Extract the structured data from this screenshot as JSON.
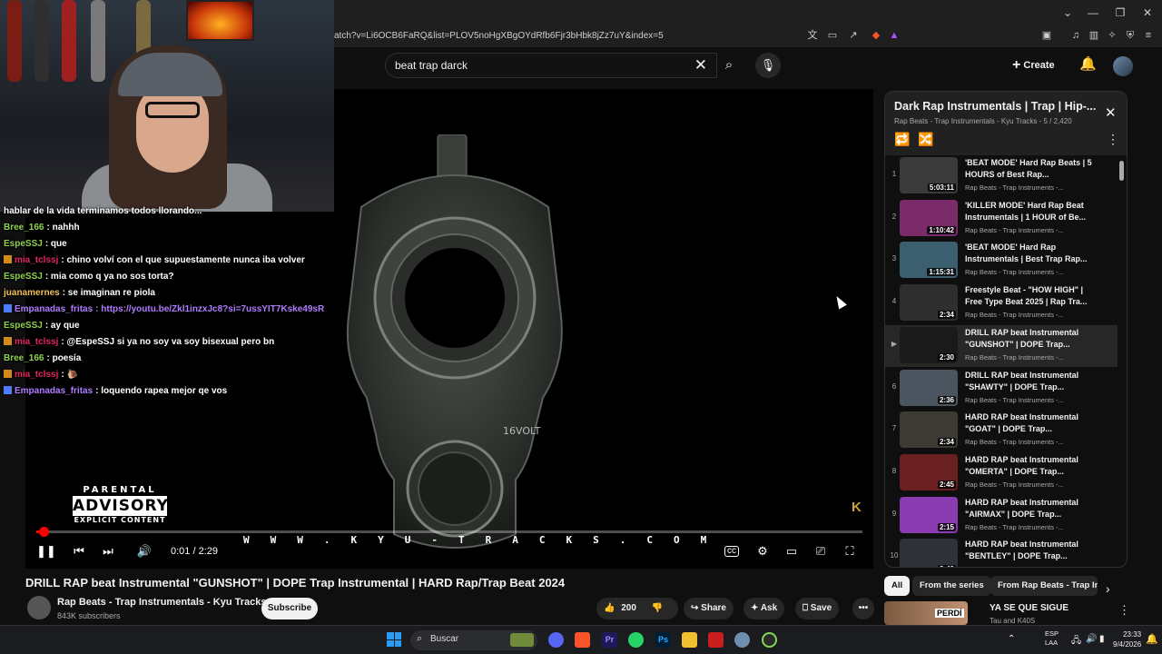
{
  "browser": {
    "url": "atch?v=Li6OCB6FaRQ&list=PLOV5noHgXBgOYdRfb6Fjr3bHbk8jZz7uY&index=5"
  },
  "header": {
    "search_value": "beat trap darck",
    "create_label": "Create"
  },
  "chat": [
    {
      "user": "hablar de la vida terminamos todos llorando...",
      "text": "",
      "color": "#ffffff",
      "badge": ""
    },
    {
      "user": "Bree_166",
      "text": ": nahhh",
      "color": "#8fd14f",
      "badge": ""
    },
    {
      "user": "EspeSSJ",
      "text": ": que",
      "color": "#8fd14f",
      "badge": ""
    },
    {
      "user": "mia_tclssj",
      "text": ": chino volví con el que supuestamente nunca iba volver",
      "color": "#e0245e",
      "badge": "orange"
    },
    {
      "user": "EspeSSJ",
      "text": ": mia como q ya no sos torta?",
      "color": "#8fd14f",
      "badge": ""
    },
    {
      "user": "juanamernes",
      "text": ": se imaginan re piola",
      "color": "#f0c05a",
      "badge": ""
    },
    {
      "user": "Empanadas_fritas",
      "text": ": https://youtu.be/Zkl1inzxJc8?si=7ussYIT7Kske49sR",
      "color": "#b07cff",
      "badge": "blue"
    },
    {
      "user": "EspeSSJ",
      "text": ": ay que",
      "color": "#8fd14f",
      "badge": ""
    },
    {
      "user": "mia_tclssj",
      "text": ": @EspeSSJ si ya no soy va soy bisexual pero bn",
      "color": "#e0245e",
      "badge": "orange"
    },
    {
      "user": "Bree_166",
      "text": ": poesía",
      "color": "#8fd14f",
      "badge": ""
    },
    {
      "user": "mia_tclssj",
      "text": ": 🐌",
      "color": "#e0245e",
      "badge": "orange"
    },
    {
      "user": "Empanadas_fritas",
      "text": ": loquendo rapea mejor qe vos",
      "color": "#b07cff",
      "badge": "blue"
    }
  ],
  "player": {
    "advisory_l1": "PARENTAL",
    "advisory_l2": "ADVISORY",
    "advisory_l3": "EXPLICIT CONTENT",
    "gun_brand": "16VOLT",
    "watermark": "K",
    "site": "WWW.KYU-TRACKS.COM",
    "time": "0:01 / 2:29",
    "progress": 0.007
  },
  "video": {
    "title": "DRILL RAP beat Instrumental \"GUNSHOT\" | DOPE Trap Instrumental | HARD Rap/Trap Beat 2024",
    "channel": "Rap Beats - Trap Instrumentals - Kyu Tracks",
    "subscribers": "843K subscribers",
    "subscribe_label": "Subscribe",
    "likes": "200",
    "share_label": "Share",
    "ask_label": "Ask",
    "save_label": "Save"
  },
  "playlist": {
    "title": "Dark Rap Instrumentals | Trap | Hip-...",
    "subtitle": "Rap Beats - Trap Instrumentals - Kyu Tracks - 5 / 2,420",
    "items": [
      {
        "idx": "1",
        "title": "'BEAT MODE' Hard Rap Beats | 5 HOURS of Best Rap...",
        "channel": "Rap Beats - Trap Instruments -...",
        "dur": "5:03:11",
        "thumb": "#3a3a3a"
      },
      {
        "idx": "2",
        "title": "'KILLER MODE' Hard Rap Beat Instrumentals | 1 HOUR of Be...",
        "channel": "Rap Beats - Trap Instruments -...",
        "dur": "1:10:42",
        "thumb": "#7b2a6a"
      },
      {
        "idx": "3",
        "title": "'BEAT MODE' Hard Rap Instrumentals | Best Trap Rap...",
        "channel": "Rap Beats - Trap Instruments -...",
        "dur": "1:15:31",
        "thumb": "#3b5f6e"
      },
      {
        "idx": "4",
        "title": "Freestyle Beat - \"HOW HIGH\" | Free Type Beat 2025 | Rap Tra...",
        "channel": "Rap Beats - Trap Instruments -...",
        "dur": "2:34",
        "thumb": "#2e2e2e"
      },
      {
        "idx": "▶",
        "title": "DRILL RAP beat Instrumental \"GUNSHOT\" | DOPE Trap...",
        "channel": "Rap Beats - Trap Instruments -...",
        "dur": "2:30",
        "thumb": "#1a1a1a"
      },
      {
        "idx": "6",
        "title": "DRILL RAP beat Instrumental \"SHAWTY\" | DOPE Trap...",
        "channel": "Rap Beats - Trap Instruments -...",
        "dur": "2:36",
        "thumb": "#4a5560"
      },
      {
        "idx": "7",
        "title": "HARD RAP beat Instrumental \"GOAT\" | DOPE Trap...",
        "channel": "Rap Beats - Trap Instruments -...",
        "dur": "2:34",
        "thumb": "#3d3a33"
      },
      {
        "idx": "8",
        "title": "HARD RAP beat Instrumental \"OMERTA\" | DOPE Trap...",
        "channel": "Rap Beats - Trap Instruments -...",
        "dur": "2:45",
        "thumb": "#6a2020"
      },
      {
        "idx": "9",
        "title": "HARD RAP beat Instrumental \"AIRMAX\" | DOPE Trap...",
        "channel": "Rap Beats - Trap Instruments -...",
        "dur": "2:15",
        "thumb": "#8a3bb0"
      },
      {
        "idx": "10",
        "title": "HARD RAP beat Instrumental \"BENTLEY\" | DOPE Trap...",
        "channel": "Rap Beats - Trap Instruments -...",
        "dur": "2:40",
        "thumb": "#2e3238"
      }
    ]
  },
  "chips": [
    "All",
    "From the series",
    "From Rap Beats - Trap In"
  ],
  "rec": {
    "title": "YA SE QUE SIGUE",
    "channel": "Tau and K40S",
    "thumb_label": "PERDÍ"
  },
  "taskbar": {
    "search_label": "Buscar",
    "lang_1": "ESP",
    "lang_2": "LAA",
    "time": "23:33",
    "date": "9/4/2026"
  }
}
